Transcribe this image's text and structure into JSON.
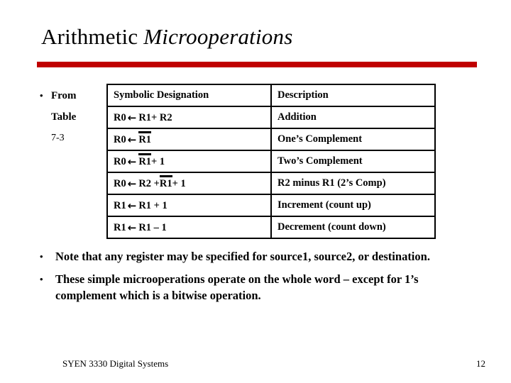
{
  "slide": {
    "title_regular": "Arithmetic ",
    "title_italic": "Microoperations",
    "rule_color": "#c00000"
  },
  "left_note": {
    "bullet_glyph": "•",
    "line1": "From",
    "line2": "Table",
    "line3": "7-3"
  },
  "table": {
    "headers": {
      "symbolic": "Symbolic Designation",
      "description": "Description"
    },
    "rows": [
      {
        "dest": "R0",
        "arrow": "←",
        "src_pre": "R1",
        "overbar": "",
        "src_post": " + R2",
        "description": "Addition"
      },
      {
        "dest": "R0",
        "arrow": "←",
        "src_pre": "",
        "overbar": "R1",
        "src_post": "",
        "description": "One’s Complement"
      },
      {
        "dest": "R0",
        "arrow": "←",
        "src_pre": "",
        "overbar": "R1",
        "src_post": " + 1",
        "description": "Two’s Complement"
      },
      {
        "dest": "R0",
        "arrow": "←",
        "src_pre": "R2 + ",
        "overbar": "R1",
        "src_post": " + 1",
        "description": "R2 minus R1 (2’s Comp)"
      },
      {
        "dest": "R1",
        "arrow": "←",
        "src_pre": "R1 + 1",
        "overbar": "",
        "src_post": "",
        "description": "Increment (count up)"
      },
      {
        "dest": "R1",
        "arrow": "←",
        "src_pre": "R1 – 1",
        "overbar": "",
        "src_post": "",
        "description": "Decrement (count down)"
      }
    ]
  },
  "body_bullets": {
    "glyph": "•",
    "items": [
      "Note that any register may be specified for source1, source2, or destination.",
      "These simple microoperations operate on the whole word – except for 1’s complement which is a bitwise operation."
    ]
  },
  "footer": {
    "course": "SYEN 3330 Digital Systems",
    "page_number": "12"
  }
}
